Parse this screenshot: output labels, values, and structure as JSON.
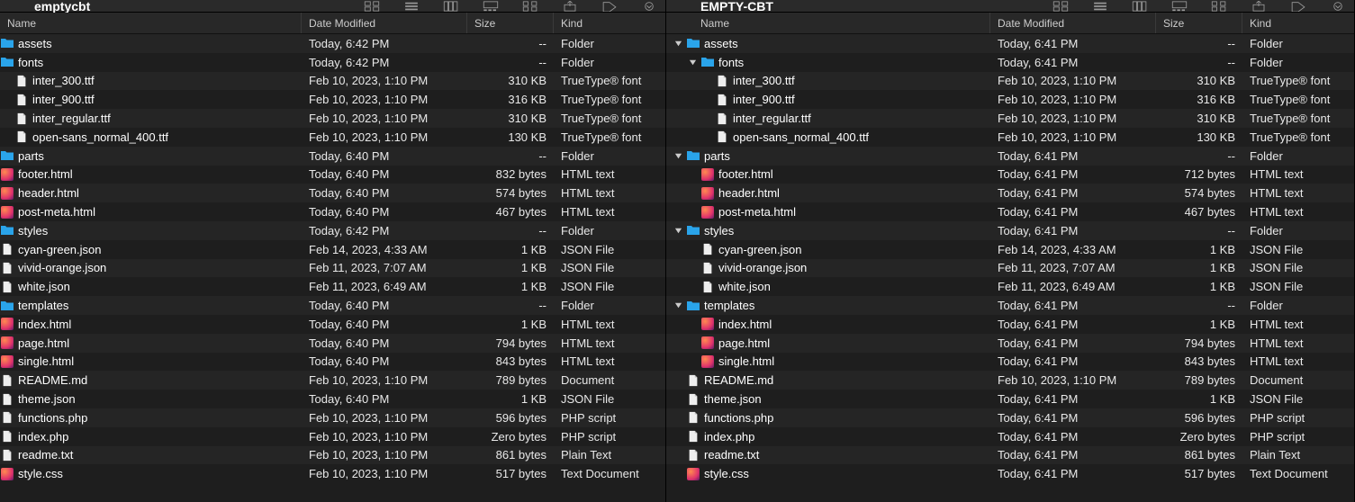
{
  "columns": {
    "name": "Name",
    "date": "Date Modified",
    "size": "Size",
    "kind": "Kind"
  },
  "panes": [
    {
      "title": "emptycbt",
      "base_indent": -1,
      "show_disclosure_col": false,
      "rows": [
        {
          "indent": 0,
          "icon": "folder",
          "name": "assets",
          "date": "Today, 6:42 PM",
          "size": "--",
          "kind": "Folder"
        },
        {
          "indent": 0,
          "icon": "folder",
          "name": "fonts",
          "date": "Today, 6:42 PM",
          "size": "--",
          "kind": "Folder"
        },
        {
          "indent": 1,
          "icon": "file",
          "name": "inter_300.ttf",
          "date": "Feb 10, 2023, 1:10 PM",
          "size": "310 KB",
          "kind": "TrueType® font"
        },
        {
          "indent": 1,
          "icon": "file",
          "name": "inter_900.ttf",
          "date": "Feb 10, 2023, 1:10 PM",
          "size": "316 KB",
          "kind": "TrueType® font"
        },
        {
          "indent": 1,
          "icon": "file",
          "name": "inter_regular.ttf",
          "date": "Feb 10, 2023, 1:10 PM",
          "size": "310 KB",
          "kind": "TrueType® font"
        },
        {
          "indent": 1,
          "icon": "file",
          "name": "open-sans_normal_400.ttf",
          "date": "Feb 10, 2023, 1:10 PM",
          "size": "130 KB",
          "kind": "TrueType® font"
        },
        {
          "indent": 0,
          "icon": "folder",
          "name": "parts",
          "date": "Today, 6:40 PM",
          "size": "--",
          "kind": "Folder"
        },
        {
          "indent": 0,
          "icon": "red",
          "name": "footer.html",
          "date": "Today, 6:40 PM",
          "size": "832 bytes",
          "kind": "HTML text"
        },
        {
          "indent": 0,
          "icon": "red",
          "name": "header.html",
          "date": "Today, 6:40 PM",
          "size": "574 bytes",
          "kind": "HTML text"
        },
        {
          "indent": 0,
          "icon": "red",
          "name": "post-meta.html",
          "date": "Today, 6:40 PM",
          "size": "467 bytes",
          "kind": "HTML text"
        },
        {
          "indent": 0,
          "icon": "folder",
          "name": "styles",
          "date": "Today, 6:42 PM",
          "size": "--",
          "kind": "Folder"
        },
        {
          "indent": 0,
          "icon": "file",
          "name": "cyan-green.json",
          "date": "Feb 14, 2023, 4:33 AM",
          "size": "1 KB",
          "kind": "JSON File"
        },
        {
          "indent": 0,
          "icon": "file",
          "name": "vivid-orange.json",
          "date": "Feb 11, 2023, 7:07 AM",
          "size": "1 KB",
          "kind": "JSON File"
        },
        {
          "indent": 0,
          "icon": "file",
          "name": "white.json",
          "date": "Feb 11, 2023, 6:49 AM",
          "size": "1 KB",
          "kind": "JSON File"
        },
        {
          "indent": -1,
          "icon": "folder",
          "name": "templates",
          "date": "Today, 6:40 PM",
          "size": "--",
          "kind": "Folder"
        },
        {
          "indent": 0,
          "icon": "red",
          "name": "index.html",
          "date": "Today, 6:40 PM",
          "size": "1 KB",
          "kind": "HTML text"
        },
        {
          "indent": 0,
          "icon": "red",
          "name": "page.html",
          "date": "Today, 6:40 PM",
          "size": "794 bytes",
          "kind": "HTML text"
        },
        {
          "indent": 0,
          "icon": "red",
          "name": "single.html",
          "date": "Today, 6:40 PM",
          "size": "843 bytes",
          "kind": "HTML text"
        },
        {
          "indent": -1,
          "icon": "file",
          "name": "README.md",
          "date": "Feb 10, 2023, 1:10 PM",
          "size": "789 bytes",
          "kind": "Document"
        },
        {
          "indent": -1,
          "icon": "file",
          "name": "theme.json",
          "date": "Today, 6:40 PM",
          "size": "1 KB",
          "kind": "JSON File"
        },
        {
          "indent": -1,
          "icon": "file",
          "name": "functions.php",
          "date": "Feb 10, 2023, 1:10 PM",
          "size": "596 bytes",
          "kind": "PHP script"
        },
        {
          "indent": -1,
          "icon": "file",
          "name": "index.php",
          "date": "Feb 10, 2023, 1:10 PM",
          "size": "Zero bytes",
          "kind": "PHP script"
        },
        {
          "indent": -1,
          "icon": "file",
          "name": "readme.txt",
          "date": "Feb 10, 2023, 1:10 PM",
          "size": "861 bytes",
          "kind": "Plain Text"
        },
        {
          "indent": -1,
          "icon": "red",
          "name": "style.css",
          "date": "Feb 10, 2023, 1:10 PM",
          "size": "517 bytes",
          "kind": "Text Document"
        }
      ]
    },
    {
      "title": "EMPTY-CBT",
      "base_indent": 0,
      "show_disclosure_col": true,
      "rows": [
        {
          "indent": 0,
          "icon": "folder",
          "name": "assets",
          "date": "Today, 6:41 PM",
          "size": "--",
          "kind": "Folder",
          "expanded": true
        },
        {
          "indent": 1,
          "icon": "folder",
          "name": "fonts",
          "date": "Today, 6:41 PM",
          "size": "--",
          "kind": "Folder",
          "expanded": true
        },
        {
          "indent": 2,
          "icon": "file",
          "name": "inter_300.ttf",
          "date": "Feb 10, 2023, 1:10 PM",
          "size": "310 KB",
          "kind": "TrueType® font"
        },
        {
          "indent": 2,
          "icon": "file",
          "name": "inter_900.ttf",
          "date": "Feb 10, 2023, 1:10 PM",
          "size": "316 KB",
          "kind": "TrueType® font"
        },
        {
          "indent": 2,
          "icon": "file",
          "name": "inter_regular.ttf",
          "date": "Feb 10, 2023, 1:10 PM",
          "size": "310 KB",
          "kind": "TrueType® font"
        },
        {
          "indent": 2,
          "icon": "file",
          "name": "open-sans_normal_400.ttf",
          "date": "Feb 10, 2023, 1:10 PM",
          "size": "130 KB",
          "kind": "TrueType® font"
        },
        {
          "indent": 0,
          "icon": "folder",
          "name": "parts",
          "date": "Today, 6:41 PM",
          "size": "--",
          "kind": "Folder",
          "expanded": true
        },
        {
          "indent": 1,
          "icon": "red",
          "name": "footer.html",
          "date": "Today, 6:41 PM",
          "size": "712 bytes",
          "kind": "HTML text"
        },
        {
          "indent": 1,
          "icon": "red",
          "name": "header.html",
          "date": "Today, 6:41 PM",
          "size": "574 bytes",
          "kind": "HTML text"
        },
        {
          "indent": 1,
          "icon": "red",
          "name": "post-meta.html",
          "date": "Today, 6:41 PM",
          "size": "467 bytes",
          "kind": "HTML text"
        },
        {
          "indent": 0,
          "icon": "folder",
          "name": "styles",
          "date": "Today, 6:41 PM",
          "size": "--",
          "kind": "Folder",
          "expanded": true
        },
        {
          "indent": 1,
          "icon": "file",
          "name": "cyan-green.json",
          "date": "Feb 14, 2023, 4:33 AM",
          "size": "1 KB",
          "kind": "JSON File"
        },
        {
          "indent": 1,
          "icon": "file",
          "name": "vivid-orange.json",
          "date": "Feb 11, 2023, 7:07 AM",
          "size": "1 KB",
          "kind": "JSON File"
        },
        {
          "indent": 1,
          "icon": "file",
          "name": "white.json",
          "date": "Feb 11, 2023, 6:49 AM",
          "size": "1 KB",
          "kind": "JSON File"
        },
        {
          "indent": 0,
          "icon": "folder",
          "name": "templates",
          "date": "Today, 6:41 PM",
          "size": "--",
          "kind": "Folder",
          "expanded": true
        },
        {
          "indent": 1,
          "icon": "red",
          "name": "index.html",
          "date": "Today, 6:41 PM",
          "size": "1 KB",
          "kind": "HTML text"
        },
        {
          "indent": 1,
          "icon": "red",
          "name": "page.html",
          "date": "Today, 6:41 PM",
          "size": "794 bytes",
          "kind": "HTML text"
        },
        {
          "indent": 1,
          "icon": "red",
          "name": "single.html",
          "date": "Today, 6:41 PM",
          "size": "843 bytes",
          "kind": "HTML text"
        },
        {
          "indent": 0,
          "icon": "file",
          "name": "README.md",
          "date": "Feb 10, 2023, 1:10 PM",
          "size": "789 bytes",
          "kind": "Document"
        },
        {
          "indent": 0,
          "icon": "file",
          "name": "theme.json",
          "date": "Today, 6:41 PM",
          "size": "1 KB",
          "kind": "JSON File"
        },
        {
          "indent": 0,
          "icon": "file",
          "name": "functions.php",
          "date": "Today, 6:41 PM",
          "size": "596 bytes",
          "kind": "PHP script"
        },
        {
          "indent": 0,
          "icon": "file",
          "name": "index.php",
          "date": "Today, 6:41 PM",
          "size": "Zero bytes",
          "kind": "PHP script"
        },
        {
          "indent": 0,
          "icon": "file",
          "name": "readme.txt",
          "date": "Today, 6:41 PM",
          "size": "861 bytes",
          "kind": "Plain Text"
        },
        {
          "indent": 0,
          "icon": "red",
          "name": "style.css",
          "date": "Today, 6:41 PM",
          "size": "517 bytes",
          "kind": "Text Document"
        }
      ]
    }
  ]
}
